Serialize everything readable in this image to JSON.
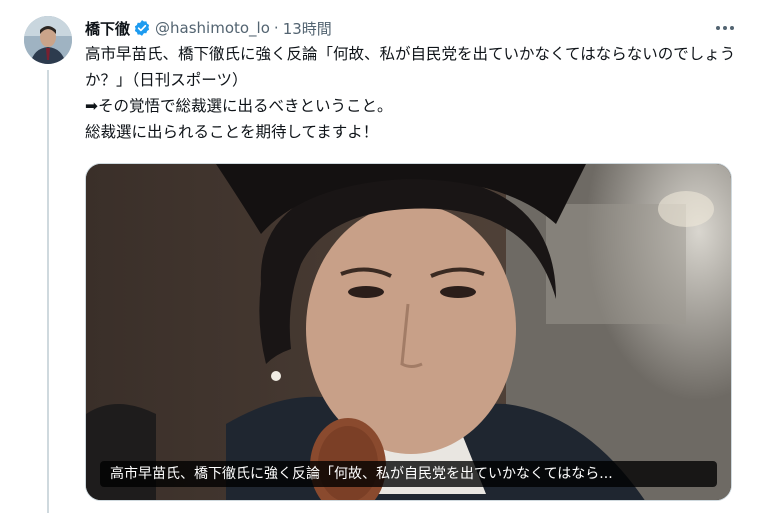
{
  "tweet": {
    "author_name": "橋下徹",
    "handle": "@hashimoto_lo",
    "separator": "·",
    "time": "13時間",
    "text": "高市早苗氏、橋下徹氏に強く反論「何故、私が自民党を出ていかなくてはならないのでしょうか？」（日刊スポーツ）\n➡その覚悟で総裁選に出るべきということ。\n総裁選に出られることを期待してますよ！",
    "verified": true,
    "icons": {
      "verified": "verified-badge-icon",
      "more": "more-icon"
    }
  },
  "card": {
    "caption": "高市早苗氏、橋下徹氏に強く反論「何故、私が自民党を出ていかなくてはなら..."
  },
  "colors": {
    "accent": "#1d9bf0",
    "text_primary": "#0f1419",
    "text_secondary": "#536471",
    "border": "#cfd9de"
  }
}
